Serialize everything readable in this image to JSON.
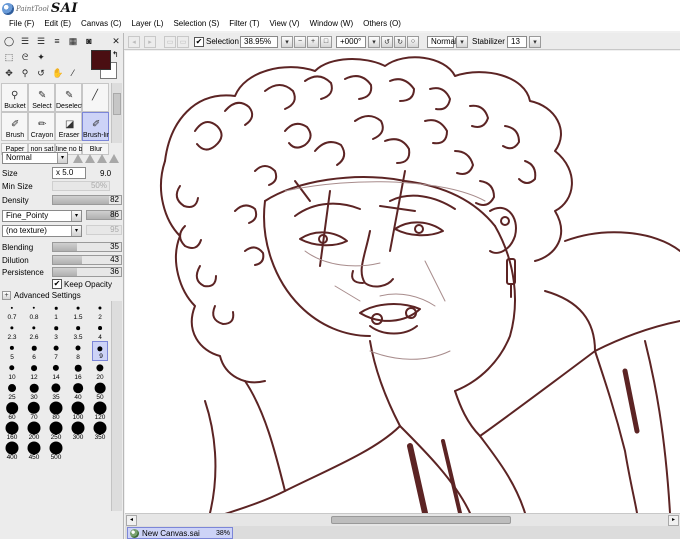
{
  "app": {
    "logo_small": "PaintTool",
    "logo_big": "SAI"
  },
  "menu": [
    {
      "label": "File (F)"
    },
    {
      "label": "Edit (E)"
    },
    {
      "label": "Canvas (C)"
    },
    {
      "label": "Layer (L)"
    },
    {
      "label": "Selection (S)"
    },
    {
      "label": "Filter (T)"
    },
    {
      "label": "View (V)"
    },
    {
      "label": "Window (W)"
    },
    {
      "label": "Others (O)"
    }
  ],
  "toolbar": {
    "selection_label": "Selection",
    "selection_checked": "✔",
    "zoom": "38.95%",
    "rotation": "+000°",
    "blend_mode": "Normal",
    "stabilizer_label": "Stabilizer",
    "stabilizer_value": "13"
  },
  "colors": {
    "primary": "#4a0e12",
    "secondary": "#ffffff",
    "selection_highlight": "#cdd3f7",
    "stroke": "#5c2424"
  },
  "brushes": [
    {
      "label": "Bucket",
      "icon": "bucket-icon"
    },
    {
      "label": "Select",
      "icon": "select-pen-icon"
    },
    {
      "label": "Deselect",
      "icon": "deselect-eraser-icon"
    },
    {
      "label": "",
      "icon": "empty-slot"
    },
    {
      "label": "Brush",
      "icon": "brush-icon"
    },
    {
      "label": "Crayon",
      "icon": "crayon-icon"
    },
    {
      "label": "Eraser",
      "icon": "eraser-icon"
    },
    {
      "label": "Brush-lin",
      "icon": "brush-line-icon",
      "selected": true
    },
    {
      "label": "Paper",
      "icon": "paper-icon"
    },
    {
      "label": "non sat",
      "icon": "non-sat-icon"
    },
    {
      "label": "line no b",
      "icon": "line-icon"
    },
    {
      "label": "Blur",
      "icon": "blur-icon"
    }
  ],
  "brush_props": {
    "mode": "Normal",
    "size_label": "Size",
    "size_multiplier": "x 5.0",
    "size_value": "9.0",
    "min_size_label": "Min Size",
    "min_size_value": "50%",
    "density_label": "Density",
    "density_value": "82",
    "shape": "Fine_Pointy",
    "shape_value": "86",
    "texture": "(no texture)",
    "texture_value": "95",
    "blending_label": "Blending",
    "blending_value": "35",
    "dilution_label": "Dilution",
    "dilution_value": "43",
    "persistence_label": "Persistence",
    "persistence_value": "36",
    "keep_opacity_label": "Keep Opacity",
    "keep_opacity_checked": "✔",
    "advanced_label": "Advanced Settings"
  },
  "sizes": [
    "0.7",
    "0.8",
    "1",
    "1.5",
    "2",
    "2.3",
    "2.6",
    "3",
    "3.5",
    "4",
    "5",
    "6",
    "7",
    "8",
    "9",
    "10",
    "12",
    "14",
    "16",
    "20",
    "25",
    "30",
    "35",
    "40",
    "50",
    "60",
    "70",
    "80",
    "100",
    "120",
    "160",
    "200",
    "250",
    "300",
    "350",
    "400",
    "450",
    "500"
  ],
  "selected_size": "9",
  "document": {
    "tab_name": "New Canvas.sai",
    "tab_zoom": "38%"
  }
}
